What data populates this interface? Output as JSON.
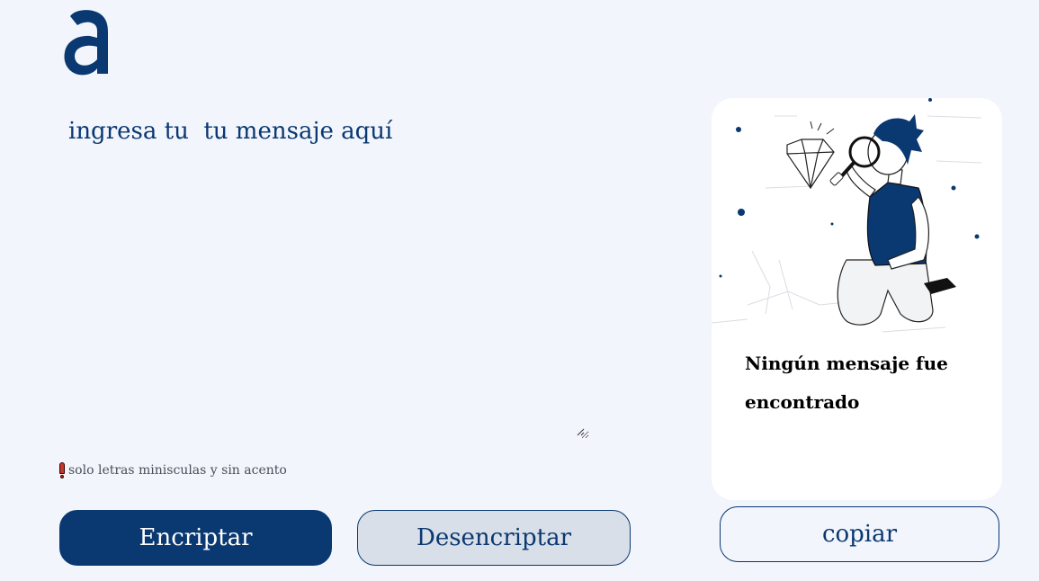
{
  "logo": {
    "icon": "alura-a-logo",
    "color": "#0a3871"
  },
  "input": {
    "placeholder": "ingresa tu  tu mensaje aquí",
    "value": ""
  },
  "hint": {
    "icon": "exclamation-icon",
    "text": "solo letras minisculas y sin acento"
  },
  "buttons": {
    "encrypt_label": "Encriptar",
    "decrypt_label": "Desencriptar",
    "copy_label": "copiar"
  },
  "output": {
    "illustration": "person-with-magnifying-glass-illustration",
    "message": "Ningún mensaje fue encontrado"
  },
  "colors": {
    "background": "#f2f5fc",
    "primary": "#0a3871",
    "secondary_button": "#d8dfe8",
    "panel": "#ffffff"
  }
}
